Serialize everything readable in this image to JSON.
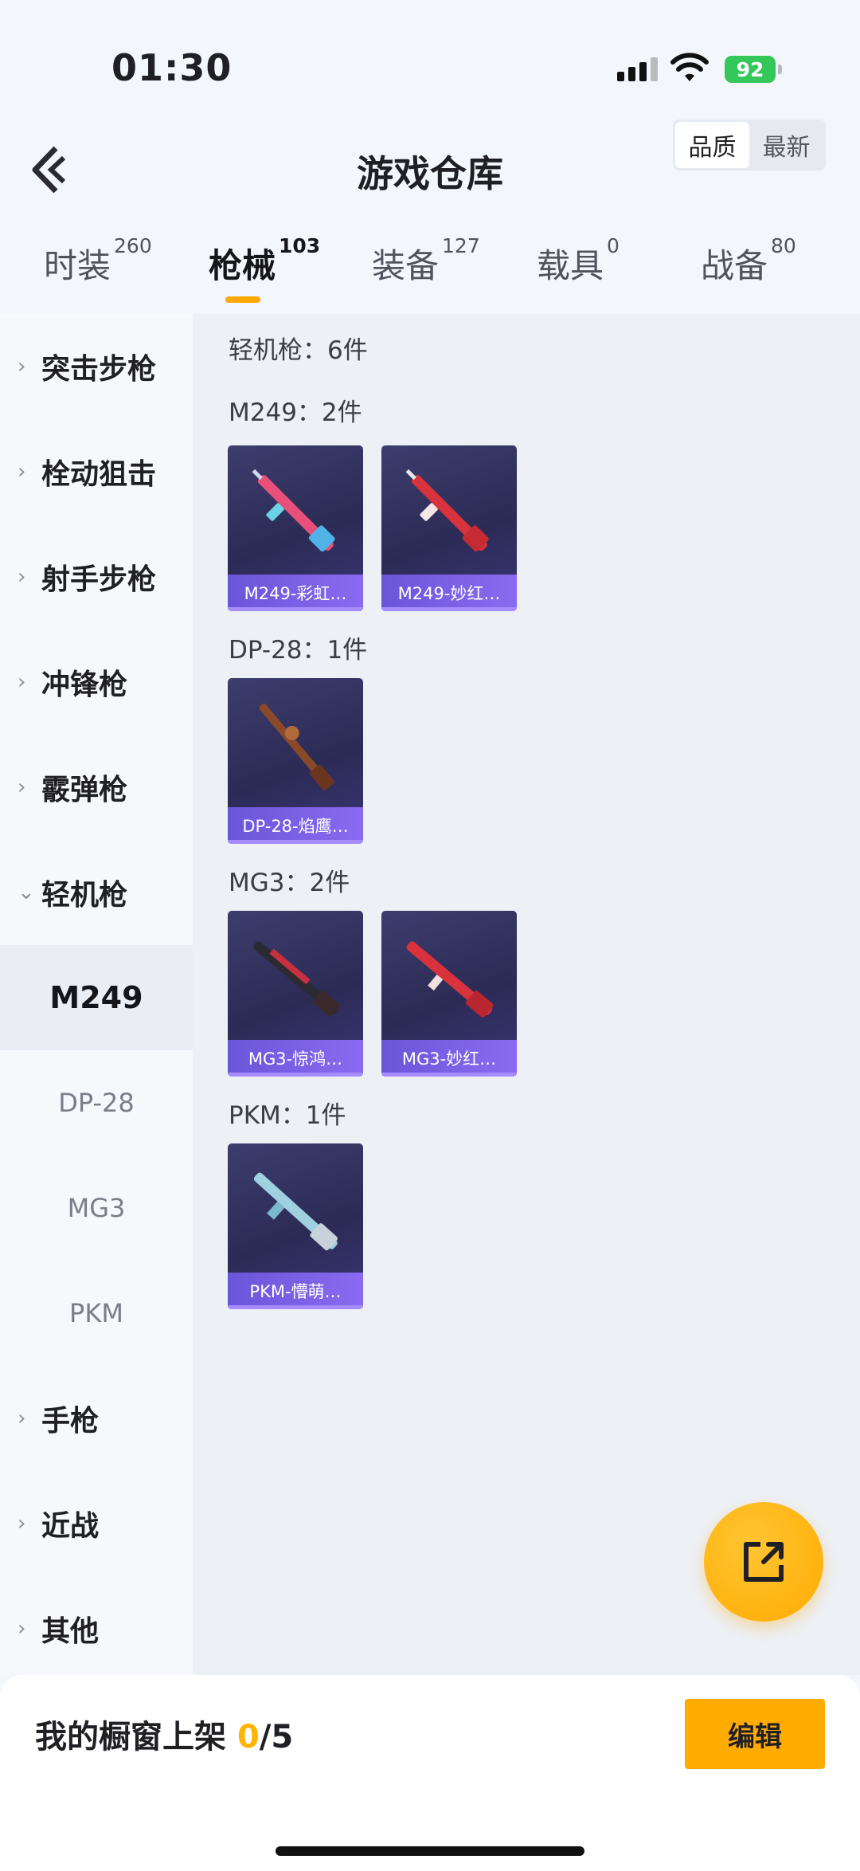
{
  "status_bar": {
    "time": "01:30",
    "battery": "92"
  },
  "header": {
    "title": "游戏仓库",
    "sort_options": [
      "品质",
      "最新"
    ]
  },
  "tabs": [
    {
      "label": "时装",
      "count": "260"
    },
    {
      "label": "枪械",
      "count": "103"
    },
    {
      "label": "装备",
      "count": "127"
    },
    {
      "label": "载具",
      "count": "0"
    },
    {
      "label": "战备",
      "count": "80"
    }
  ],
  "sidebar": {
    "categories_top": [
      "突击步枪",
      "栓动狙击",
      "射手步枪",
      "冲锋枪",
      "霰弹枪",
      "轻机枪"
    ],
    "subitems": [
      "M249",
      "DP-28",
      "MG3",
      "PKM"
    ],
    "categories_bottom": [
      "手枪",
      "近战",
      "其他"
    ]
  },
  "content": {
    "group_title": "轻机枪：6件",
    "groups": [
      {
        "title": "M249：2件",
        "items": [
          "M249-彩虹…",
          "M249-妙红…"
        ]
      },
      {
        "title": "DP-28：1件",
        "items": [
          "DP-28-焰鹰…"
        ]
      },
      {
        "title": "MG3：2件",
        "items": [
          "MG3-惊鸿…",
          "MG3-妙红…"
        ]
      },
      {
        "title": "PKM：1件",
        "items": [
          "PKM-懵萌…"
        ]
      }
    ]
  },
  "bottom": {
    "label": "我的橱窗上架 ",
    "current": "0",
    "total": "/5",
    "edit_label": "编辑"
  },
  "colors": {
    "accent": "#ffab00",
    "card_caption": "#7a60e6"
  }
}
